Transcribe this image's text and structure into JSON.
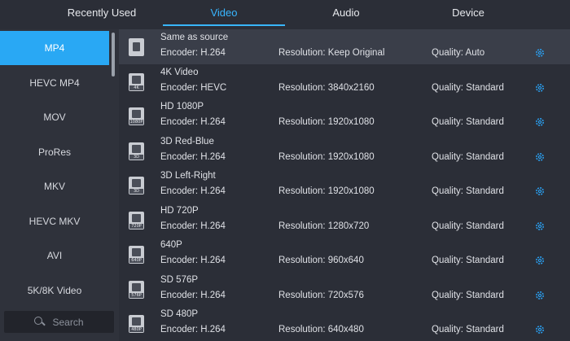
{
  "tabs": [
    {
      "label": "Recently Used",
      "active": false
    },
    {
      "label": "Video",
      "active": true
    },
    {
      "label": "Audio",
      "active": false
    },
    {
      "label": "Device",
      "active": false
    }
  ],
  "sidebar": {
    "items": [
      {
        "label": "MP4",
        "active": true
      },
      {
        "label": "HEVC MP4",
        "active": false
      },
      {
        "label": "MOV",
        "active": false
      },
      {
        "label": "ProRes",
        "active": false
      },
      {
        "label": "MKV",
        "active": false
      },
      {
        "label": "HEVC MKV",
        "active": false
      },
      {
        "label": "AVI",
        "active": false
      },
      {
        "label": "5K/8K Video",
        "active": false
      }
    ],
    "search_placeholder": "Search"
  },
  "presets": [
    {
      "name": "Same as source",
      "encoder": "Encoder: H.264",
      "resolution": "Resolution: Keep Original",
      "quality": "Quality: Auto",
      "icon": "file-icon",
      "tag": "",
      "selected": true
    },
    {
      "name": "4K Video",
      "encoder": "Encoder: HEVC",
      "resolution": "Resolution: 3840x2160",
      "quality": "Quality: Standard",
      "icon": "4k-icon",
      "tag": "4K",
      "selected": false
    },
    {
      "name": "HD 1080P",
      "encoder": "Encoder: H.264",
      "resolution": "Resolution: 1920x1080",
      "quality": "Quality: Standard",
      "icon": "1080p-icon",
      "tag": "1080P",
      "selected": false
    },
    {
      "name": "3D Red-Blue",
      "encoder": "Encoder: H.264",
      "resolution": "Resolution: 1920x1080",
      "quality": "Quality: Standard",
      "icon": "3d-icon",
      "tag": "3D",
      "selected": false
    },
    {
      "name": "3D Left-Right",
      "encoder": "Encoder: H.264",
      "resolution": "Resolution: 1920x1080",
      "quality": "Quality: Standard",
      "icon": "3d-icon",
      "tag": "3D",
      "selected": false
    },
    {
      "name": "HD 720P",
      "encoder": "Encoder: H.264",
      "resolution": "Resolution: 1280x720",
      "quality": "Quality: Standard",
      "icon": "720p-icon",
      "tag": "720P",
      "selected": false
    },
    {
      "name": "640P",
      "encoder": "Encoder: H.264",
      "resolution": "Resolution: 960x640",
      "quality": "Quality: Standard",
      "icon": "640p-icon",
      "tag": "640P",
      "selected": false
    },
    {
      "name": "SD 576P",
      "encoder": "Encoder: H.264",
      "resolution": "Resolution: 720x576",
      "quality": "Quality: Standard",
      "icon": "576p-icon",
      "tag": "576P",
      "selected": false
    },
    {
      "name": "SD 480P",
      "encoder": "Encoder: H.264",
      "resolution": "Resolution: 640x480",
      "quality": "Quality: Standard",
      "icon": "480p-icon",
      "tag": "480P",
      "selected": false
    }
  ],
  "colors": {
    "accent": "#38b6ff",
    "sidebar_active": "#29a8f4",
    "background": "#2b2e37",
    "row_selected": "#3a3e49"
  }
}
